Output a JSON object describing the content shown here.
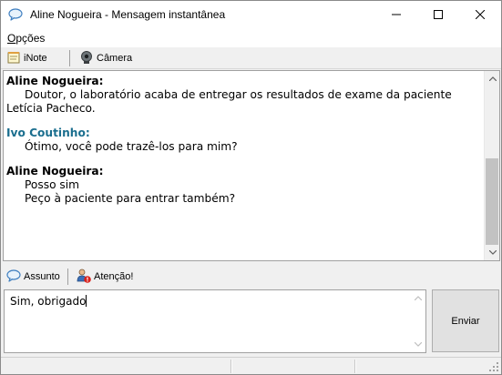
{
  "window": {
    "title": "Aline Nogueira - Mensagem instantânea",
    "icon": "chat-bubble-icon"
  },
  "menu": {
    "options_accel": "O",
    "options_rest": "pções"
  },
  "toolbar": {
    "inote_label": "iNote",
    "camera_label": "Câmera"
  },
  "messages": [
    {
      "sender": "Aline Nogueira:",
      "lines": [
        "Doutor, o laboratório acaba de entregar os resultados de exame da paciente Letícia Pacheco."
      ]
    },
    {
      "sender": "Ivo Coutinho:",
      "lines": [
        "Ótimo, você pode trazê-los para mim?"
      ]
    },
    {
      "sender": "Aline Nogueira:",
      "lines": [
        "Posso sim",
        "Peço à paciente para entrar também?"
      ]
    }
  ],
  "compose_toolbar": {
    "subject_label": "Assunto",
    "attention_label": "Atenção!"
  },
  "compose": {
    "value": "Sim, obrigado"
  },
  "send_label": "Enviar",
  "colors": {
    "other_sender": "#1a6e8e",
    "self_sender": "#000000"
  }
}
